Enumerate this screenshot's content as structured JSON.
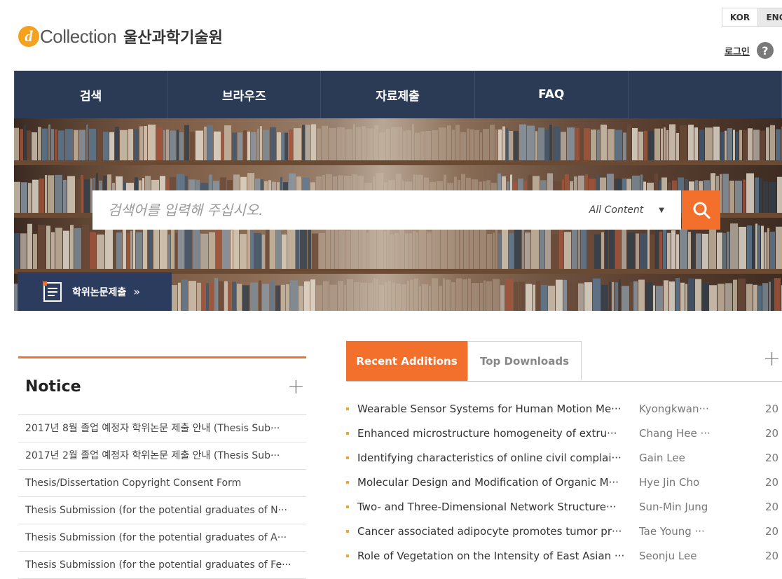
{
  "header": {
    "logo_letter": "d",
    "logo_text": "Collection",
    "org_name": "울산과학기술원",
    "lang_primary": "KOR",
    "lang_secondary": "ENG",
    "login_label": "로그인",
    "help_symbol": "?"
  },
  "nav": {
    "items": [
      {
        "label": "검색"
      },
      {
        "label": "브라우즈"
      },
      {
        "label": "자료제출"
      },
      {
        "label": "FAQ"
      },
      {
        "label": ""
      }
    ]
  },
  "hero": {
    "search_placeholder": "검색어를 입력해 주십시오.",
    "scope_label": "All Content",
    "scope_caret": "▼",
    "thesis_button_label": "학위논문제출",
    "thesis_button_arrow": "»"
  },
  "notice": {
    "title": "Notice",
    "plus": "+",
    "items": [
      "2017년 8월 졸업 예정자 학위논문 제출 안내 (Thesis Sub···",
      "2017년 2월 졸업 예정자 학위논문 제출 안내 (Thesis Sub···",
      "Thesis/Dissertation Copyright Consent Form",
      "Thesis Submission (for the potential graduates of N···",
      "Thesis Submission (for the potential graduates of A···",
      "Thesis Submission (for the potential graduates of Fe···"
    ]
  },
  "recent": {
    "tab_active": "Recent Additions",
    "tab_inactive": "Top Downloads",
    "plus": "+",
    "items": [
      {
        "title": "Wearable Sensor Systems for Human Motion Me···",
        "author": "Kyongkwan···",
        "year": "20"
      },
      {
        "title": "Enhanced microstructure homogeneity of extru···",
        "author": "Chang Hee ···",
        "year": "20"
      },
      {
        "title": "Identifying characteristics of online civil complai···",
        "author": "Gain Lee",
        "year": "20"
      },
      {
        "title": "Molecular Design and Modification of Organic M···",
        "author": "Hye Jin Cho",
        "year": "20"
      },
      {
        "title": "Two- and Three-Dimensional Network Structure···",
        "author": "Sun-Min Jung",
        "year": "20"
      },
      {
        "title": "Cancer associated adipocyte promotes tumor pr···",
        "author": "Tae Young ···",
        "year": "20"
      },
      {
        "title": "Role of Vegetation on the Intensity of East Asian ···",
        "author": "Seonju Lee",
        "year": "20"
      }
    ]
  },
  "colors": {
    "accent": "#f36f2c",
    "nav_bg": "#2b3a55",
    "logo": "#f4a21e"
  }
}
